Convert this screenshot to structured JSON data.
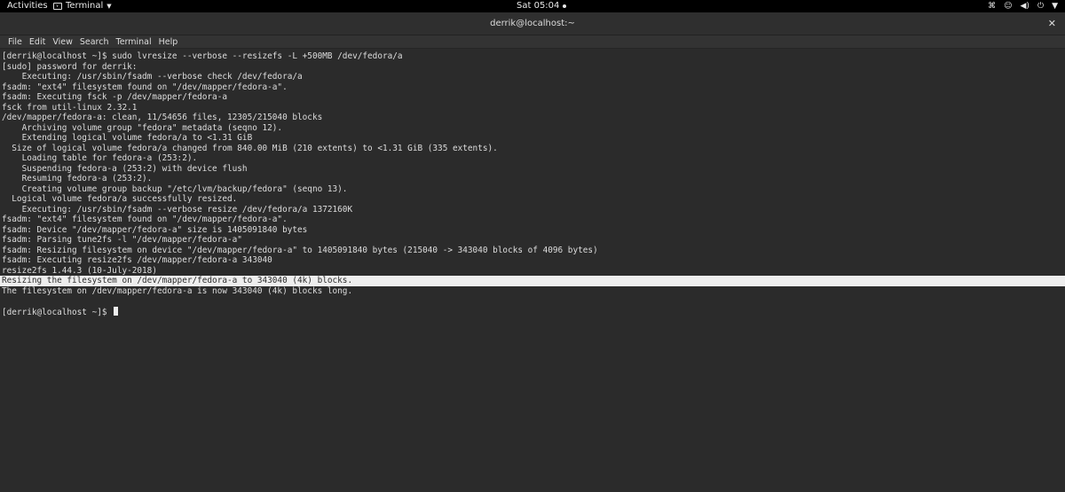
{
  "topbar": {
    "activities": "Activities",
    "app_name": "Terminal",
    "clock": "Sat 05:04"
  },
  "window": {
    "title": "derrik@localhost:~"
  },
  "menu": [
    "File",
    "Edit",
    "View",
    "Search",
    "Terminal",
    "Help"
  ],
  "terminal": {
    "lines": [
      "[derrik@localhost ~]$ sudo lvresize --verbose --resizefs -L +500MB /dev/fedora/a",
      "[sudo] password for derrik:",
      "    Executing: /usr/sbin/fsadm --verbose check /dev/fedora/a",
      "fsadm: \"ext4\" filesystem found on \"/dev/mapper/fedora-a\".",
      "fsadm: Executing fsck -p /dev/mapper/fedora-a",
      "fsck from util-linux 2.32.1",
      "/dev/mapper/fedora-a: clean, 11/54656 files, 12305/215040 blocks",
      "    Archiving volume group \"fedora\" metadata (seqno 12).",
      "    Extending logical volume fedora/a to <1.31 GiB",
      "  Size of logical volume fedora/a changed from 840.00 MiB (210 extents) to <1.31 GiB (335 extents).",
      "    Loading table for fedora-a (253:2).",
      "    Suspending fedora-a (253:2) with device flush",
      "    Resuming fedora-a (253:2).",
      "    Creating volume group backup \"/etc/lvm/backup/fedora\" (seqno 13).",
      "  Logical volume fedora/a successfully resized.",
      "    Executing: /usr/sbin/fsadm --verbose resize /dev/fedora/a 1372160K",
      "fsadm: \"ext4\" filesystem found on \"/dev/mapper/fedora-a\".",
      "fsadm: Device \"/dev/mapper/fedora-a\" size is 1405091840 bytes",
      "fsadm: Parsing tune2fs -l \"/dev/mapper/fedora-a\"",
      "fsadm: Resizing filesystem on device \"/dev/mapper/fedora-a\" to 1405091840 bytes (215040 -> 343040 blocks of 4096 bytes)",
      "fsadm: Executing resize2fs /dev/mapper/fedora-a 343040",
      "resize2fs 1.44.3 (10-July-2018)",
      "Resizing the filesystem on /dev/mapper/fedora-a to 343040 (4k) blocks.",
      "The filesystem on /dev/mapper/fedora-a is now 343040 (4k) blocks long.",
      "",
      "[derrik@localhost ~]$ "
    ],
    "highlighted_line": 22,
    "cursor_line": 25
  }
}
